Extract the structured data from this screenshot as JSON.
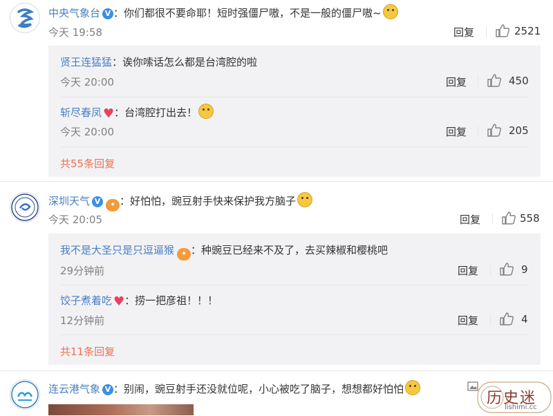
{
  "comments": [
    {
      "name": "中央气象台",
      "text": "：你们都很不要命耶！短时强僵尸嗷，不是一般的僵尸嗷~",
      "time": "今天 19:58",
      "reply": "回复",
      "likes": "2521",
      "replies": [
        {
          "name": "贤王连猛猛",
          "text": "：诶你嗦话怎么都是台湾腔的啦",
          "time": "今天 20:00",
          "reply": "回复",
          "likes": "450"
        },
        {
          "name": "斩尽春凤",
          "text": "：台湾腔打出去！",
          "time": "今天 20:00",
          "reply": "回复",
          "likes": "205"
        }
      ],
      "more": "共55条回复"
    },
    {
      "name": "深圳天气",
      "text": "：好怕怕，豌豆射手快来保护我方脑子",
      "time": "今天 20:05",
      "reply": "回复",
      "likes": "558",
      "replies": [
        {
          "name": "我不是大圣只是只逗逼猴",
          "text": "：种豌豆已经来不及了，去买辣椒和樱桃吧",
          "time": "29分钟前",
          "reply": "回复",
          "likes": "9"
        },
        {
          "name": "饺子煮着吃",
          "text": "：捞一把彦祖！！！",
          "time": "12分钟前",
          "reply": "回复",
          "likes": "4"
        }
      ],
      "more": "共11条回复"
    },
    {
      "name": "连云港气象",
      "text": "：别闹，豌豆射手还没就位呢，小心被吃了脑子，想想都好怕怕"
    }
  ],
  "watermark": {
    "text": "历史迷",
    "url": "lishimi.cc"
  },
  "colors": {
    "name": "#eb7350",
    "reply_bg": "#f2f2f5",
    "verified": "#3a8ee6"
  }
}
